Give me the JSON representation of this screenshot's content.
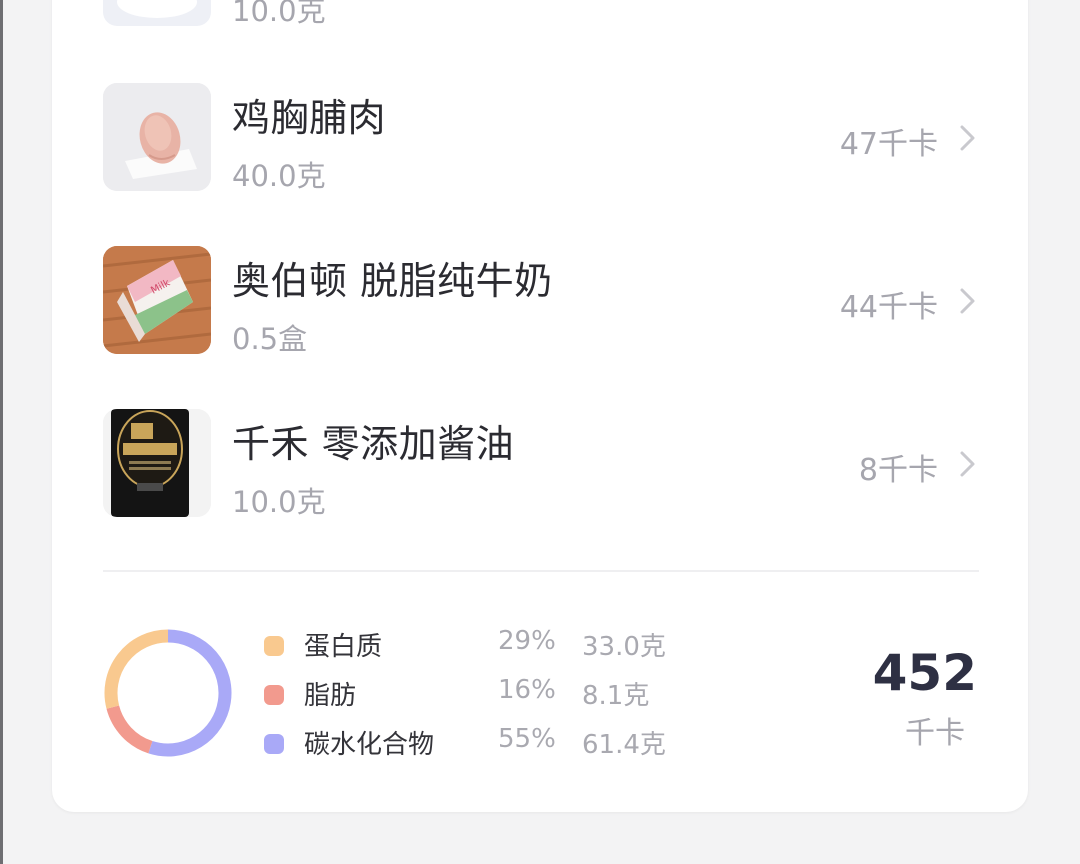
{
  "food_list": {
    "partial_item": {
      "amount": "10.0克"
    },
    "items": [
      {
        "name": "鸡胸脯肉",
        "amount": "40.0克",
        "calories": "47千卡",
        "image": "chicken-breast-photo"
      },
      {
        "name": "奥伯顿 脱脂纯牛奶",
        "amount": "0.5盒",
        "calories": "44千卡",
        "image": "milk-carton-photo"
      },
      {
        "name": "千禾 零添加酱油",
        "amount": "10.0克",
        "calories": "8千卡",
        "image": "soy-sauce-bottle-photo"
      }
    ]
  },
  "nutrition_summary": {
    "macros": [
      {
        "name": "蛋白质",
        "percent": "29%",
        "grams": "33.0克",
        "color": "#f9c98f",
        "fraction": 0.29
      },
      {
        "name": "脂肪",
        "percent": "16%",
        "grams": "8.1克",
        "color": "#f29a8e",
        "fraction": 0.16
      },
      {
        "name": "碳水化合物",
        "percent": "55%",
        "grams": "61.4克",
        "color": "#a9a9f7",
        "fraction": 0.55
      }
    ],
    "total_calories": "452",
    "total_unit": "千卡"
  }
}
